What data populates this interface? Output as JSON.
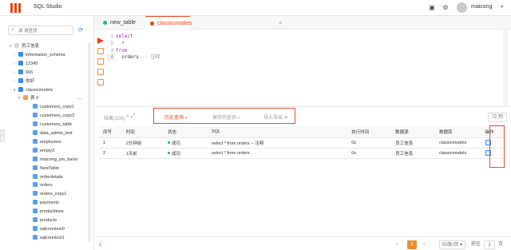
{
  "app": {
    "title": "SQL Studio",
    "username": "maicong"
  },
  "colors": {
    "accent": "#ed4014",
    "primary": "#2d8cf0",
    "success": "#19be6b",
    "highlight": "#e84a3c"
  },
  "sidebar": {
    "search_placeholder": "请 请查找",
    "tree": [
      {
        "label": "员工信息",
        "level": 0,
        "arrow": "▾",
        "icon": "root"
      },
      {
        "label": "information_schema",
        "level": 1,
        "arrow": "›",
        "icon": "db"
      },
      {
        "label": "12345",
        "level": 1,
        "arrow": "›",
        "icon": "db"
      },
      {
        "label": "666",
        "level": 1,
        "arrow": "›",
        "icon": "db"
      },
      {
        "label": "你好",
        "level": 1,
        "arrow": "›",
        "icon": "db"
      },
      {
        "label": "classicmodels",
        "level": 1,
        "arrow": "▾",
        "icon": "db"
      },
      {
        "label": "表 #",
        "level": 2,
        "arrow": "▾",
        "icon": "folder"
      },
      {
        "label": "customers_copy1",
        "level": 3,
        "arrow": "",
        "icon": "table"
      },
      {
        "label": "customers_copy3",
        "level": 3,
        "arrow": "",
        "icon": "table"
      },
      {
        "label": "customers_table",
        "level": 3,
        "arrow": "",
        "icon": "table"
      },
      {
        "label": "data_admin_test",
        "level": 3,
        "arrow": "",
        "icon": "table"
      },
      {
        "label": "employees",
        "level": 3,
        "arrow": "",
        "icon": "table"
      },
      {
        "label": "empty3",
        "level": 3,
        "arrow": "",
        "icon": "table"
      },
      {
        "label": "maicong_ym_backi",
        "level": 3,
        "arrow": "",
        "icon": "table"
      },
      {
        "label": "NewTable",
        "level": 3,
        "arrow": "",
        "icon": "table"
      },
      {
        "label": "orderdetails",
        "level": 3,
        "arrow": "",
        "icon": "table"
      },
      {
        "label": "orders",
        "level": 3,
        "arrow": "",
        "icon": "table"
      },
      {
        "label": "orders_copy1",
        "level": 3,
        "arrow": "",
        "icon": "table"
      },
      {
        "label": "payments",
        "level": 3,
        "arrow": "",
        "icon": "table"
      },
      {
        "label": "productlines",
        "level": 3,
        "arrow": "",
        "icon": "table"
      },
      {
        "label": "products",
        "level": 3,
        "arrow": "",
        "icon": "table"
      },
      {
        "label": "sqlconntest0",
        "level": 3,
        "arrow": "",
        "icon": "table"
      },
      {
        "label": "sqlconntest1",
        "level": 3,
        "arrow": "",
        "icon": "table"
      }
    ],
    "more": "—"
  },
  "tabs": [
    {
      "label": "new_table"
    },
    {
      "label": "classicmodels",
      "close": "×"
    }
  ],
  "editor": {
    "lines": [
      {
        "num": "1",
        "parts": [
          {
            "t": "select",
            "c": "kw"
          }
        ]
      },
      {
        "num": "2",
        "parts": [
          {
            "t": "  *",
            "c": "kw"
          }
        ]
      },
      {
        "num": "3",
        "parts": [
          {
            "t": "from",
            "c": "kw"
          }
        ]
      },
      {
        "num": "4",
        "parts": [
          {
            "t": "  orders ",
            "c": ""
          },
          {
            "t": "-- 注释",
            "c": "cm"
          }
        ]
      }
    ]
  },
  "results": {
    "count_label": "结果(326)",
    "tabs": {
      "history": "历史查询",
      "saved": "保存的查询",
      "import_export": "导入导出"
    },
    "columns_button": "列"
  },
  "history": {
    "headers": [
      "序号",
      "时间",
      "状态",
      "SQL",
      "执行时间",
      "数据源",
      "数据库",
      "操作"
    ],
    "rows": [
      {
        "no": "1",
        "time": "2分钟前",
        "status": "成功",
        "sql": "select * from orders -- 注释",
        "exec": "0s",
        "source": "员工信息",
        "db": "classicmodels"
      },
      {
        "no": "2",
        "time": "1天前",
        "status": "成功",
        "sql": "select * from orders",
        "exec": "0s",
        "source": "员工信息",
        "db": "classicmodels"
      }
    ]
  },
  "pagination": {
    "prev": "‹",
    "current": "1",
    "next": "›",
    "page_size": "50条/页",
    "goto_label": "前往",
    "goto_value": "1",
    "page_unit": "页"
  }
}
